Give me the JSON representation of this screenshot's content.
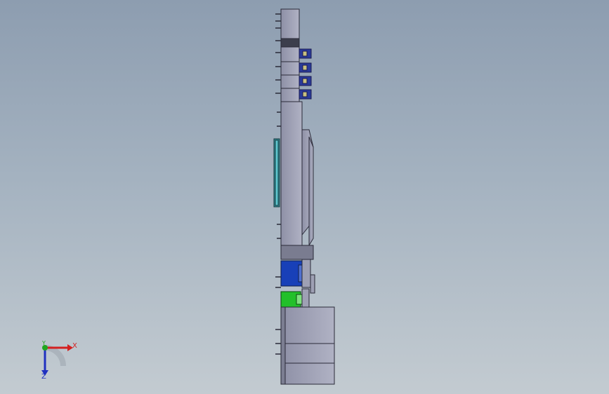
{
  "triad": {
    "x_label": "X",
    "y_label": "Y",
    "z_label": "Z",
    "x_color": "#d42020",
    "y_color": "#1fa61f",
    "z_color": "#2030c0"
  },
  "model": {
    "body_color": "#9ea0b4",
    "edge_color": "#2a2a38",
    "blue_connector_color": "#1840b8",
    "green_connector_color": "#22c02a",
    "teal_part_color": "#3aaab0"
  }
}
